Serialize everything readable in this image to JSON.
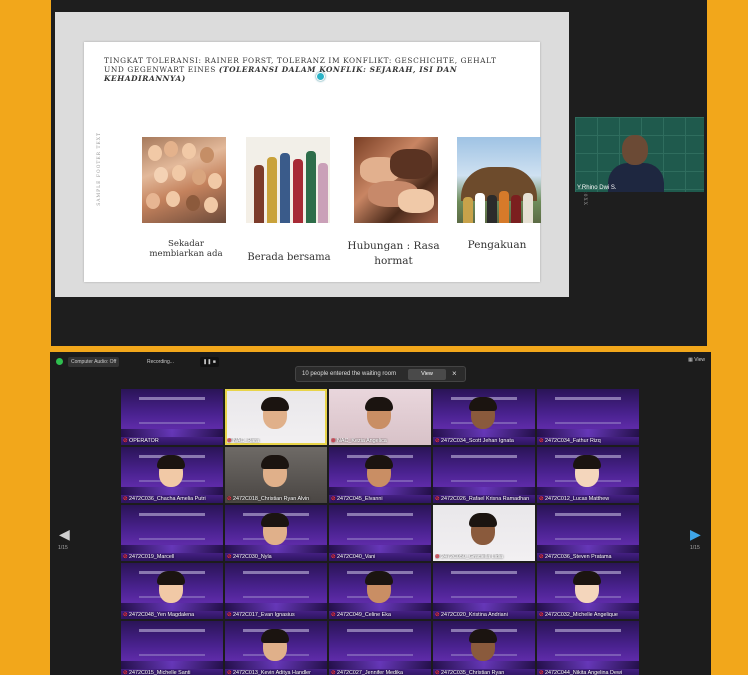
{
  "slide": {
    "title_main": "Tingkat Toleransi: Rainer Forst,",
    "title_rest": "Toleranz im Konflikt: Geschichte, Gehalt und Gegenwart eines",
    "title_paren": "(Toleransi dalam Konflik: Sejarah, Isi dan Kehadirannya)",
    "side_left": "SAMPLE FOOTER TEXT",
    "side_right": "2/1/20XX",
    "captions": [
      "Sekadar membiarkan ada",
      "Berada bersama",
      "Hubungan : Rasa hormat",
      "Pengakuan"
    ]
  },
  "presenter": {
    "label": "Y.Rhino Dwi S."
  },
  "gallery": {
    "recording_chip": "Computer Audio: Off",
    "recording_label": "Recording...",
    "view_label": "View",
    "notification": {
      "text": "10 people entered the waiting room",
      "button": "View",
      "close": "×"
    },
    "page_left": "1/15",
    "page_right": "1/15",
    "tiles": [
      {
        "label": "OPERATOR",
        "style": "poster"
      },
      {
        "label": "NAC_Rara",
        "style": "light"
      },
      {
        "label": "NAC_Kezia Angelica",
        "style": "pink"
      },
      {
        "label": "2472C034_Scott Jehan Ignata",
        "style": "poster"
      },
      {
        "label": "2472C034_Fathur Rizq",
        "style": "poster"
      },
      {
        "label": "2472C036_Chacha Amelia Putri",
        "style": "poster"
      },
      {
        "label": "2472C018_Christian Ryan Alvin",
        "style": "room"
      },
      {
        "label": "2472C045_Elvanni",
        "style": "poster"
      },
      {
        "label": "2472C026_Rafael Krisna Ramadhan",
        "style": "poster"
      },
      {
        "label": "2472C012_Lucas Matthew",
        "style": "poster"
      },
      {
        "label": "2472C019_Marcell",
        "style": "poster"
      },
      {
        "label": "2472C030_Nyla",
        "style": "poster"
      },
      {
        "label": "2472C040_Vani",
        "style": "poster"
      },
      {
        "label": "2472C050_Graciella Lidia",
        "style": "light"
      },
      {
        "label": "2472C036_Steven Pratama",
        "style": "poster"
      },
      {
        "label": "2472C048_Yen Magdalena",
        "style": "poster"
      },
      {
        "label": "2472C017_Evan Ignasius",
        "style": "poster"
      },
      {
        "label": "2472C049_Celine Eka",
        "style": "poster"
      },
      {
        "label": "2472C020_Kristina Andriani",
        "style": "poster"
      },
      {
        "label": "2472C032_Michelle Angelique",
        "style": "poster"
      },
      {
        "label": "2472C015_Michelle Santi",
        "style": "poster"
      },
      {
        "label": "2472C013_Kevin Aditya Handler",
        "style": "poster"
      },
      {
        "label": "2472C027_Jennifer Medika",
        "style": "poster"
      },
      {
        "label": "2472C035_Christian Ryan",
        "style": "poster"
      },
      {
        "label": "2472C044_Nikita Angelina Dewi",
        "style": "poster"
      }
    ]
  }
}
